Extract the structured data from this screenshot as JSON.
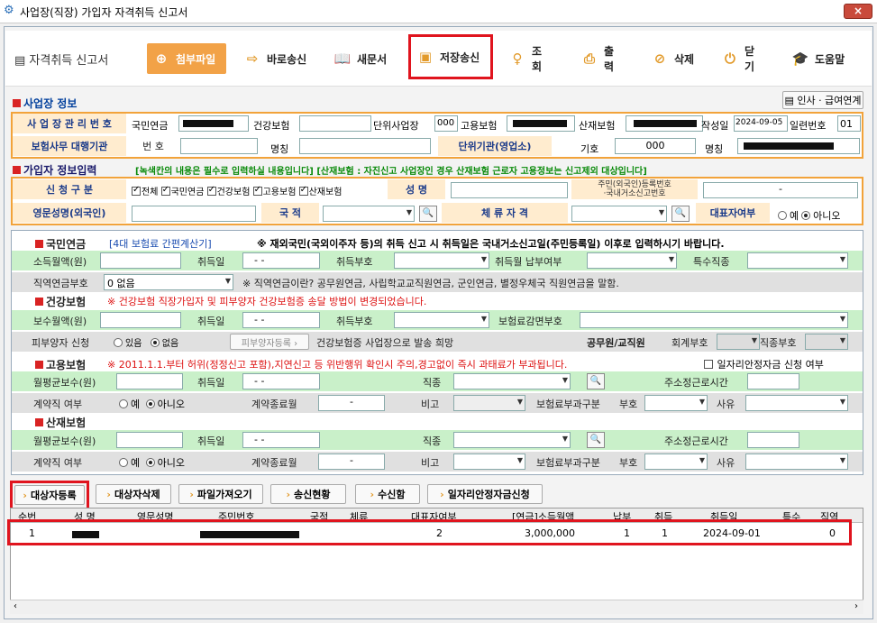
{
  "window": {
    "title": "사업장(직장) 가입자 자격취득 신고서",
    "close": "×"
  },
  "toolbar": {
    "heading": "자격취득 신고서",
    "buttons": [
      "첨부파일",
      "바로송신",
      "새문서",
      "저장송신",
      "조회",
      "출력",
      "삭제",
      "닫기",
      "도움말"
    ]
  },
  "workplace": {
    "section_title": "사업장 정보",
    "insa_button": "인사 · 급여연계",
    "mgmt_no_label": "사 업 장 관 리 번 호",
    "pension_label": "국민연금",
    "health_label": "건강보험",
    "unit_label": "단위사업장",
    "unit_value": "000",
    "employment_label": "고용보험",
    "accident_label": "산재보험",
    "created_label": "작성일",
    "created_value": "2024-09-05",
    "serial_label": "일련번호",
    "serial_value": "01",
    "agent_label": "보험사무 대행기관",
    "number_label": "번 호",
    "name_label": "명칭",
    "unit_org_label": "단위기관(영업소)",
    "code_label": "기호",
    "code_value": "000",
    "name2_label": "명칭"
  },
  "subscriber": {
    "section_title": "가입자 정보입력",
    "notice": "[녹색칸의 내용은 필수로 입력하실 내용입니다]  [산재보험 : 자진신고 사업장인 경우 산재보험 근로자 고용정보는 신고제외 대상입니다]",
    "apply_label": "신 청 구 분",
    "checks": [
      "전체",
      "국민연금",
      "건강보험",
      "고용보험",
      "산재보험"
    ],
    "name_label": "성 명",
    "rrn_label": "주민(외국인)등록번호\n·국내거소신고번호",
    "rrn_value": "-",
    "eng_name_label": "영문성명(외국인)",
    "nation_label": "국 적",
    "stay_label": "체 류 자 격",
    "rep_label": "대표자여부",
    "rep_options": [
      "예",
      "아니오"
    ]
  },
  "pension": {
    "title": "국민연금",
    "calc_link": "[4대 보험료 간편계산기]",
    "notice": "※ 재외국민(국외이주자 등)의 취득 신고 시 취득일은 국내거소신고일(주민등록일) 이후로 입력하시기 바랍니다.",
    "income_label": "소득월액(원)",
    "acq_date_label": "취득일",
    "acq_date_value": "- -",
    "acq_code_label": "취득부호",
    "pay_label": "취득월 납부여부",
    "special_label": "특수직종",
    "pension_code_label": "직역연금부호",
    "pension_code_value": "0      없음",
    "pension_note": "※ 직역연금이란? 공무원연금, 사립학교교직원연금, 군인연금, 별정우체국 직원연금을 말함."
  },
  "health": {
    "title": "건강보험",
    "notice": "※ 건강보험 직장가입자 및 피부양자 건강보험증 송달 방법이 변경되었습니다.",
    "wage_label": "보수월액(원)",
    "acq_date_label": "취득일",
    "acq_date_value": "- -",
    "acq_code_label": "취득부호",
    "reduce_label": "보험료감면부호",
    "dependent_label": "피부양자 신청",
    "dep_options": [
      "있음",
      "없음"
    ],
    "dep_button": "피부양자등록 ›",
    "card_note": "건강보험증 사업장으로 발송 희망",
    "official_label": "공무원/교직원",
    "account_label": "회계부호",
    "job_label": "직종부호"
  },
  "employment": {
    "title": "고용보험",
    "notice": "※ 2011.1.1.부터 허위(정정신고 포함),지연신고 등 위반행위 확인시 주의,경고없이 즉시 과태료가 부과됩니다.",
    "job_support": "일자리안정자금 신청 여부",
    "avg_wage_label": "월평균보수(원)",
    "acq_date_label": "취득일",
    "acq_date_value": "- -",
    "job_label": "직종",
    "hours_label": "주소정근로시간",
    "contract_label": "계약직 여부",
    "contract_options": [
      "예",
      "아니오"
    ],
    "end_label": "계약종료월",
    "end_value": "-",
    "note_label": "비고",
    "premium_label": "보험료부과구분",
    "code_label": "부호",
    "reason_label": "사유"
  },
  "accident": {
    "title": "산재보험",
    "avg_wage_label": "월평균보수(원)",
    "acq_date_label": "취득일",
    "acq_date_value": "- -",
    "job_label": "직종",
    "hours_label": "주소정근로시간",
    "contract_label": "계약직 여부",
    "contract_options": [
      "예",
      "아니오"
    ],
    "end_label": "계약종료월",
    "end_value": "-",
    "note_label": "비고",
    "premium_label": "보험료부과구분",
    "code_label": "부호",
    "reason_label": "사유"
  },
  "actions": [
    "대상자등록",
    "대상자삭제",
    "파일가져오기",
    "송신현황",
    "수신함",
    "일자리안정자금신청"
  ],
  "grid": {
    "headers": [
      "순번",
      "성 명",
      "영문성명",
      "주민번호",
      "국적",
      "체류",
      "대표자여부",
      "[연금]소득월액",
      "납부",
      "취득",
      "취득일",
      "특수",
      "직역"
    ],
    "rows": [
      {
        "no": "1",
        "rep": "2",
        "income": "3,000,000",
        "pay": "1",
        "acq": "1",
        "date": "2024-09-01",
        "special": "0"
      }
    ]
  },
  "colors": {
    "accent": "#f2a247",
    "highlight": "#e0141e",
    "required": "#c9f0c9",
    "label_bg": "#ffeccf",
    "title_blue": "#003f9c"
  }
}
